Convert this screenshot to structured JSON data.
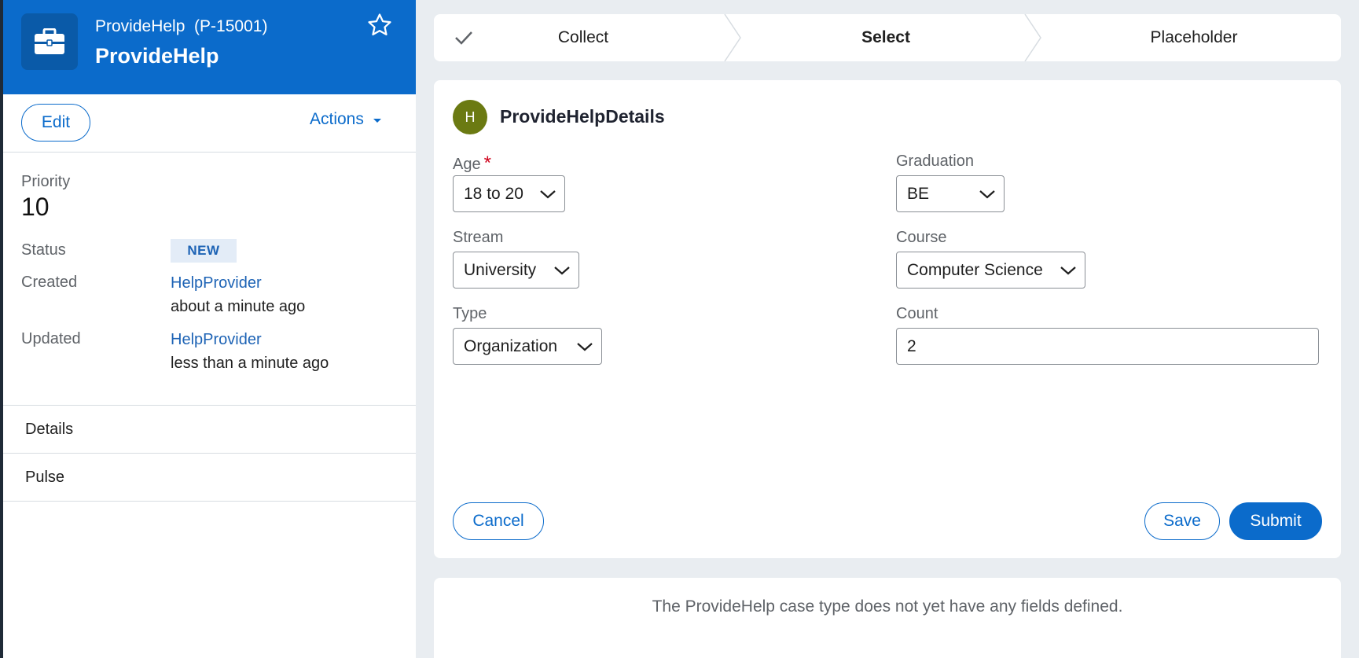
{
  "case": {
    "id": "ProvideHelp  (P-15001)",
    "title": "ProvideHelp",
    "edit_label": "Edit",
    "actions_label": "Actions"
  },
  "summary": {
    "priority_label": "Priority",
    "priority_value": "10",
    "status_label": "Status",
    "status_value": "NEW",
    "created_label": "Created",
    "created_by": "HelpProvider",
    "created_when": "about a minute ago",
    "updated_label": "Updated",
    "updated_by": "HelpProvider",
    "updated_when": "less than a minute ago"
  },
  "nav": {
    "details": "Details",
    "pulse": "Pulse"
  },
  "stages": [
    {
      "label": "Collect",
      "state": "completed"
    },
    {
      "label": "Select",
      "state": "current"
    },
    {
      "label": "Placeholder",
      "state": "future"
    }
  ],
  "form": {
    "avatar_letter": "H",
    "title": "ProvideHelpDetails",
    "age_label": "Age",
    "age_required": "*",
    "age_value": "18 to 20",
    "graduation_label": "Graduation",
    "graduation_value": "BE",
    "stream_label": "Stream",
    "stream_value": "University",
    "course_label": "Course",
    "course_value": "Computer Science",
    "type_label": "Type",
    "type_value": "Organization",
    "count_label": "Count",
    "count_value": "2",
    "cancel_label": "Cancel",
    "save_label": "Save",
    "submit_label": "Submit"
  },
  "info": {
    "message": "The ProvideHelp case type does not yet have any fields defined."
  },
  "colors": {
    "brand": "#0b6bcb",
    "avatar": "#6b7a12",
    "required": "#d0021b"
  }
}
